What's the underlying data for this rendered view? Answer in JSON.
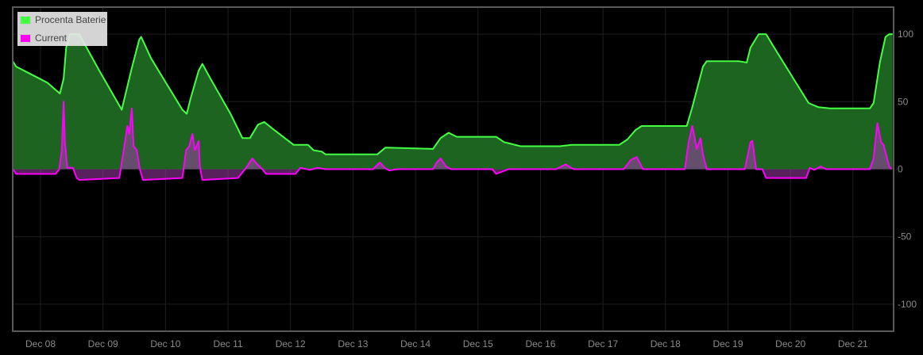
{
  "chart_data": {
    "type": "area",
    "title": "",
    "xlabel": "",
    "ylabel": "",
    "x_unit": "days since Dec 08 00:00",
    "xlim": [
      -0.445,
      13.65
    ],
    "ylim": [
      -120,
      120
    ],
    "grid": true,
    "legend_position": "top-left",
    "x_ticks": [
      {
        "value": 0,
        "label": "Dec 08"
      },
      {
        "value": 1,
        "label": "Dec 09"
      },
      {
        "value": 2,
        "label": "Dec 10"
      },
      {
        "value": 3,
        "label": "Dec 11"
      },
      {
        "value": 4,
        "label": "Dec 12"
      },
      {
        "value": 5,
        "label": "Dec 13"
      },
      {
        "value": 6,
        "label": "Dec 14"
      },
      {
        "value": 7,
        "label": "Dec 15"
      },
      {
        "value": 8,
        "label": "Dec 16"
      },
      {
        "value": 9,
        "label": "Dec 17"
      },
      {
        "value": 10,
        "label": "Dec 18"
      },
      {
        "value": 11,
        "label": "Dec 19"
      },
      {
        "value": 12,
        "label": "Dec 20"
      },
      {
        "value": 13,
        "label": "Dec 21"
      }
    ],
    "y_ticks": [
      {
        "value": 100,
        "label": "100"
      },
      {
        "value": 50,
        "label": "50"
      },
      {
        "value": 0,
        "label": "0"
      },
      {
        "value": -50,
        "label": "-50"
      },
      {
        "value": -100,
        "label": "-100"
      }
    ],
    "series": [
      {
        "name": "Procenta Baterie",
        "color": "#44ff44",
        "fill": "#1d6420",
        "points": [
          [
            -0.445,
            80
          ],
          [
            -0.39,
            76
          ],
          [
            -0.14,
            70
          ],
          [
            0.11,
            64
          ],
          [
            0.31,
            56
          ],
          [
            0.37,
            67
          ],
          [
            0.41,
            90
          ],
          [
            0.47,
            100
          ],
          [
            0.62,
            100
          ],
          [
            0.69,
            94
          ],
          [
            0.94,
            73
          ],
          [
            1.3,
            44
          ],
          [
            1.45,
            73
          ],
          [
            1.58,
            96
          ],
          [
            1.61,
            98
          ],
          [
            1.77,
            82
          ],
          [
            2.27,
            44
          ],
          [
            2.34,
            41
          ],
          [
            2.4,
            52
          ],
          [
            2.53,
            73
          ],
          [
            2.59,
            78
          ],
          [
            2.72,
            67
          ],
          [
            3.04,
            41
          ],
          [
            3.23,
            23
          ],
          [
            3.35,
            23
          ],
          [
            3.48,
            33
          ],
          [
            3.58,
            35
          ],
          [
            3.74,
            29
          ],
          [
            4.05,
            18
          ],
          [
            4.28,
            18
          ],
          [
            4.37,
            14
          ],
          [
            4.5,
            13
          ],
          [
            4.56,
            11
          ],
          [
            5.39,
            11
          ],
          [
            5.52,
            16
          ],
          [
            6.28,
            15
          ],
          [
            6.4,
            23
          ],
          [
            6.53,
            27
          ],
          [
            6.66,
            24
          ],
          [
            7.29,
            24
          ],
          [
            7.42,
            20
          ],
          [
            7.68,
            17
          ],
          [
            8.31,
            17
          ],
          [
            8.5,
            18
          ],
          [
            9.26,
            18
          ],
          [
            9.39,
            22
          ],
          [
            9.52,
            29
          ],
          [
            9.62,
            32
          ],
          [
            10.34,
            32
          ],
          [
            10.43,
            46
          ],
          [
            10.6,
            76
          ],
          [
            10.66,
            80
          ],
          [
            11.17,
            80
          ],
          [
            11.3,
            79
          ],
          [
            11.36,
            90
          ],
          [
            11.49,
            100
          ],
          [
            11.61,
            100
          ],
          [
            11.74,
            90
          ],
          [
            12.29,
            49
          ],
          [
            12.44,
            46
          ],
          [
            12.63,
            45
          ],
          [
            13.27,
            45
          ],
          [
            13.33,
            49
          ],
          [
            13.43,
            79
          ],
          [
            13.52,
            98
          ],
          [
            13.58,
            100
          ],
          [
            13.634,
            100
          ]
        ]
      },
      {
        "name": "Current",
        "color": "#ff00ff",
        "fill": "rgba(160,60,170,0.55)",
        "points": [
          [
            -0.44,
            0
          ],
          [
            -0.39,
            -3.5
          ],
          [
            0.24,
            -3.5
          ],
          [
            0.3,
            0
          ],
          [
            0.34,
            14
          ],
          [
            0.37,
            50
          ],
          [
            0.39,
            20
          ],
          [
            0.43,
            1
          ],
          [
            0.52,
            1
          ],
          [
            0.58,
            -6.5
          ],
          [
            0.62,
            -8
          ],
          [
            1.26,
            -6.5
          ],
          [
            1.32,
            11
          ],
          [
            1.39,
            32
          ],
          [
            1.42,
            26
          ],
          [
            1.46,
            45
          ],
          [
            1.49,
            17
          ],
          [
            1.54,
            14
          ],
          [
            1.59,
            0
          ],
          [
            1.64,
            -8
          ],
          [
            2.27,
            -6.5
          ],
          [
            2.33,
            14
          ],
          [
            2.38,
            17
          ],
          [
            2.43,
            26
          ],
          [
            2.47,
            14
          ],
          [
            2.53,
            21
          ],
          [
            2.55,
            2
          ],
          [
            2.59,
            -8
          ],
          [
            3.16,
            -6.5
          ],
          [
            3.29,
            1
          ],
          [
            3.39,
            8
          ],
          [
            3.44,
            5
          ],
          [
            3.55,
            0
          ],
          [
            3.61,
            -3.5
          ],
          [
            4.08,
            -3.5
          ],
          [
            4.16,
            1
          ],
          [
            4.31,
            -0.5
          ],
          [
            4.43,
            1
          ],
          [
            4.56,
            0
          ],
          [
            5.32,
            0
          ],
          [
            5.43,
            5
          ],
          [
            5.51,
            1
          ],
          [
            5.58,
            -1
          ],
          [
            5.71,
            0
          ],
          [
            6.28,
            0
          ],
          [
            6.34,
            5
          ],
          [
            6.4,
            8
          ],
          [
            6.49,
            2
          ],
          [
            6.57,
            0
          ],
          [
            7.23,
            0
          ],
          [
            7.29,
            -3.5
          ],
          [
            7.49,
            0
          ],
          [
            8.25,
            0
          ],
          [
            8.4,
            3.5
          ],
          [
            8.53,
            0
          ],
          [
            9.33,
            0
          ],
          [
            9.45,
            7
          ],
          [
            9.54,
            9
          ],
          [
            9.64,
            0
          ],
          [
            10.31,
            0
          ],
          [
            10.37,
            20
          ],
          [
            10.43,
            32
          ],
          [
            10.5,
            15
          ],
          [
            10.56,
            23
          ],
          [
            10.6,
            11
          ],
          [
            10.66,
            0
          ],
          [
            11.27,
            0
          ],
          [
            11.36,
            20
          ],
          [
            11.39,
            21
          ],
          [
            11.45,
            0
          ],
          [
            11.55,
            0
          ],
          [
            11.61,
            -6.5
          ],
          [
            12.25,
            -6.5
          ],
          [
            12.31,
            1
          ],
          [
            12.38,
            -0.5
          ],
          [
            12.48,
            2
          ],
          [
            12.57,
            0
          ],
          [
            13.27,
            0
          ],
          [
            13.33,
            8
          ],
          [
            13.39,
            34
          ],
          [
            13.45,
            20
          ],
          [
            13.49,
            18
          ],
          [
            13.58,
            2
          ],
          [
            13.62,
            0
          ]
        ]
      }
    ]
  }
}
